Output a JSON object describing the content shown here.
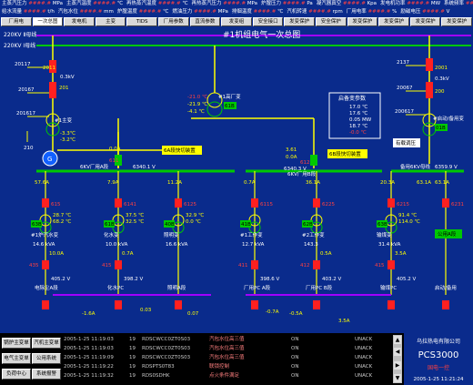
{
  "ticker": {
    "row1": [
      {
        "label": "主蒸汽压力",
        "value": "####.#",
        "unit": "MPa"
      },
      {
        "label": "主蒸汽温度",
        "value": "####.#",
        "unit": "℃"
      },
      {
        "label": "再热蒸汽温度",
        "value": "####.#",
        "unit": "℃"
      },
      {
        "label": "再热蒸汽压力",
        "value": "####.#",
        "unit": "MPa"
      },
      {
        "label": "炉膛压力",
        "value": "####.#",
        "unit": "Pa"
      },
      {
        "label": "凝汽器真空",
        "value": "####.#",
        "unit": "Kpa"
      },
      {
        "label": "发电机功率",
        "value": "####.#",
        "unit": "MW"
      },
      {
        "label": "系统频率",
        "value": "####.#",
        "unit": "Hz"
      }
    ],
    "row2": [
      {
        "label": "给水流量",
        "value": "####.#",
        "unit": "t/h"
      },
      {
        "label": "汽包水位",
        "value": "####.#",
        "unit": "mm"
      },
      {
        "label": "炉膛温度",
        "value": "####.#",
        "unit": "℃"
      },
      {
        "label": "燃油压力",
        "value": "####.#",
        "unit": "MPa"
      },
      {
        "label": "排烟温度",
        "value": "####.#",
        "unit": "℃"
      },
      {
        "label": "汽机转速",
        "value": "####.#",
        "unit": "rpm"
      },
      {
        "label": "厂用电率",
        "value": "####.#",
        "unit": "%"
      },
      {
        "label": "励磁电压",
        "value": "####.#",
        "unit": "V"
      }
    ]
  },
  "menu": [
    "厂用电",
    "一次总图",
    "发电机",
    "主变",
    "TIDS",
    "厂用参数",
    "直流参数",
    "发变组",
    "安全接口",
    "发变保护",
    "安全保护",
    "发变保护",
    "发变保护",
    "发变保护",
    "发变保护"
  ],
  "diagram": {
    "bus_220_ii": "220KV Ⅱ母线",
    "bus_220_i": "220KV Ⅰ母线",
    "title": "#1机组电气一次总图",
    "left_feeder": {
      "sw1": "20117",
      "sw2": "2011",
      "sw3": "20167",
      "sw4": "201",
      "sw5": "201617",
      "kv": "0.3kV",
      "transformer": "#1主变",
      "neutral": "210",
      "val_a": "-3.3℃",
      "val_b": "-3.2℃"
    },
    "gen_label": "G",
    "house_tx": {
      "name": "#1高厂变",
      "code": "61B",
      "v1": "-21.0 ℃",
      "v2": "-21.9 ℃",
      "v3": "-4.1 ℃"
    },
    "standby_params": {
      "title": "启备变参数",
      "rows": [
        "17.0 ℃",
        "17.6 ℃",
        "0.05 MW",
        "18.7 ℃",
        "-0.0 ℃"
      ]
    },
    "right_feeder": {
      "sw1": "2137",
      "sw2": "2001",
      "sw3": "20067",
      "sw4": "200",
      "sw5": "200617",
      "name": "#启动/备用变",
      "code": "01B",
      "kv": "0.3kV"
    },
    "regulate_btn": "有载调压",
    "fast_switch_a": "6A段快切装置",
    "fast_switch_b": "6B段快切装置",
    "bus_a": {
      "name": "6KV厂用A段",
      "voltage": "6340.1 V",
      "incoming_amp": "0.0A",
      "incoming_kw": "8.97",
      "breaker": "611"
    },
    "bus_b": {
      "name": "6KV厂用B段",
      "voltage": "6340.3 V",
      "incoming_amp": "3.61",
      "incoming_kw": "0.0A",
      "breaker": "612"
    },
    "bus_standby": {
      "name": "备用6KV母线",
      "voltage": "6359.9 V",
      "amp": "63.1A"
    },
    "feeders": [
      {
        "amp": "57.6A",
        "code": "615",
        "tx": "63B",
        "name": "#1炉汽水变",
        "t1": "28.7 ℃",
        "t2": "68.2 ℃",
        "load": "14.6 kVA",
        "cap": "10.0A",
        "lv": "405.2 V",
        "lv_breaker": "435",
        "lvbus": "电除尘A段"
      },
      {
        "amp": "7.9A",
        "code": "6141",
        "tx": "61B",
        "name": "化水变",
        "t1": "37.5 ℃",
        "t2": "32.5 ℃",
        "load": "10.0 kVA",
        "cap": "0.7A",
        "lv": "398.2 V",
        "lv_breaker": "415",
        "lvbus": "化水PC"
      },
      {
        "amp": "11.2A",
        "code": "6125",
        "tx": "40B",
        "name": "照明变",
        "t1": "32.9 ℃",
        "t2": "0.0 ℃",
        "load": "16.6 kVA",
        "cap": "",
        "lv": "",
        "lv_breaker": "",
        "lvbus": "照明A段"
      },
      {
        "amp": "0.7A",
        "code": "6115",
        "tx": "41B",
        "name": "#1工作变",
        "t1": "",
        "t2": "",
        "load": "12.7 kVA",
        "cap": "",
        "lv": "398.6 V",
        "lv_breaker": "411",
        "lvbus": "厂用PC A段"
      },
      {
        "amp": "36.1A",
        "code": "6225",
        "tx": "62B",
        "name": "#2工作变",
        "t1": "",
        "t2": "",
        "load": "143.3",
        "cap": "0.5A",
        "lv": "403.2 V",
        "lv_breaker": "412",
        "lvbus": "厂用PC B段"
      },
      {
        "amp": "20.3A",
        "code": "6215",
        "tx": "63B",
        "name": "输煤变",
        "t1": "91.4 ℃",
        "t2": "114.0 ℃",
        "load": "31.4 kVA",
        "cap": "3.5A",
        "lv": "405.2 V",
        "lv_breaker": "415",
        "lvbus": "输煤PC"
      },
      {
        "amp": "63.1A",
        "code": "6231",
        "tx": "",
        "name": "",
        "t1": "",
        "t2": "",
        "load": "",
        "cap": "",
        "lv": "",
        "lv_breaker": "",
        "lvbus": "启动/备用"
      }
    ],
    "low_currents": [
      "-1.6A",
      "0.03",
      "0.07",
      "-0.7A",
      "-0.5A",
      "3.5A"
    ],
    "spare_label": "公用A段"
  },
  "left_buttons": [
    "锅炉主变单",
    "汽机主变单",
    "电气主变单",
    "公用系统",
    "负荷中心",
    "系统报警"
  ],
  "events": [
    {
      "time": "2005-1-25  11:19:03",
      "no": "19",
      "code": "RDSCWCC0ZT0S03",
      "desc": "汽包水位高三值",
      "state": "ON",
      "ack": "UNACK"
    },
    {
      "time": "2005-1-25  11:19:03",
      "no": "19",
      "code": "RDSCWCC0ZT0S03",
      "desc": "汽包水位高三值",
      "state": "ON",
      "ack": "UNACK"
    },
    {
      "time": "2005-1-25  11:19:09",
      "no": "19",
      "code": "RDSCWCC0ZT0S03",
      "desc": "汽包水位高三值",
      "state": "ON",
      "ack": "UNACK"
    },
    {
      "time": "2005-1-25  11:19:22",
      "no": "19",
      "code": "RDSPTS0T83",
      "desc": "联锁控制",
      "state": "ON",
      "ack": "UNACK"
    },
    {
      "time": "2005-1-25  11:19:32",
      "no": "19",
      "code": "RDS0SDHK",
      "desc": "点火条件满足",
      "state": "ON",
      "ack": "UNACK"
    }
  ],
  "logo": {
    "company": "乌拉热电有限公司",
    "product": "PCS3000",
    "subtitle": "国电一控",
    "datetime": "2005-1-25  11:21:24"
  },
  "colors": {
    "background": "#0a2b8c",
    "bus_green": "#00c800",
    "breaker_red": "#ff2020",
    "label_yellow": "#ffff00",
    "bus_purple": "#a000ff"
  }
}
